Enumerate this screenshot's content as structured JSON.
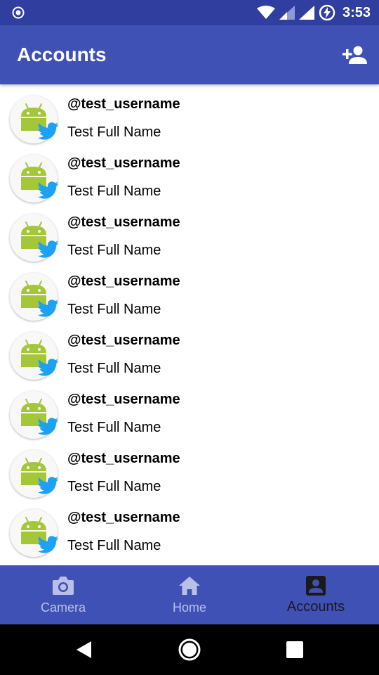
{
  "status_bar": {
    "time": "3:53",
    "icons": [
      "notification-circle-icon",
      "wifi-icon",
      "signal-icon",
      "signal-full-icon",
      "battery-charging-icon"
    ]
  },
  "app_bar": {
    "title": "Accounts",
    "action_icon": "add-person-icon"
  },
  "accounts": [
    {
      "username": "@test_username",
      "full_name": "Test Full Name"
    },
    {
      "username": "@test_username",
      "full_name": "Test Full Name"
    },
    {
      "username": "@test_username",
      "full_name": "Test Full Name"
    },
    {
      "username": "@test_username",
      "full_name": "Test Full Name"
    },
    {
      "username": "@test_username",
      "full_name": "Test Full Name"
    },
    {
      "username": "@test_username",
      "full_name": "Test Full Name"
    },
    {
      "username": "@test_username",
      "full_name": "Test Full Name"
    },
    {
      "username": "@test_username",
      "full_name": "Test Full Name"
    }
  ],
  "bottom_nav": {
    "items": [
      {
        "label": "Camera",
        "icon": "camera-icon",
        "active": false
      },
      {
        "label": "Home",
        "icon": "home-icon",
        "active": false
      },
      {
        "label": "Accounts",
        "icon": "account-box-icon",
        "active": true
      }
    ]
  },
  "colors": {
    "primary": "#3f51b5",
    "primary_dark": "#303f9f",
    "inactive_nav": "#b8c0e8",
    "active_nav": "#1a1a1a",
    "twitter_blue": "#1da1f2",
    "android_green": "#a4c639"
  }
}
